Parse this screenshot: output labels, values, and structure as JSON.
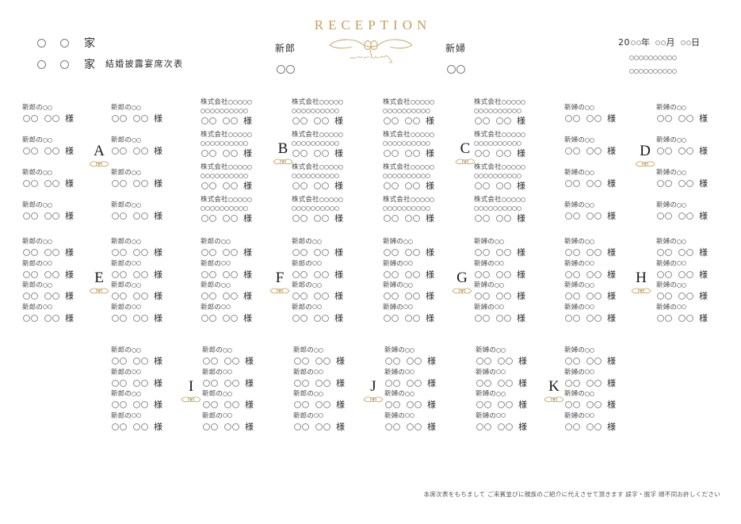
{
  "header": {
    "family_rows": [
      "家",
      "家"
    ],
    "subtitle": "結婚披露宴席次表",
    "reception_title": "RECEPTION",
    "ornament_script": "classic wedding",
    "groom_label": "新郎",
    "bride_label": "新婦",
    "date": {
      "year_prefix": "20",
      "year_suffix": "年",
      "month_suffix": "月",
      "day_suffix": "日"
    }
  },
  "labels": {
    "groom_relation": "新郎の",
    "bride_relation": "新婦の",
    "company": "株式会社",
    "honorific": "様"
  },
  "colors": {
    "gold": "#c2a05c",
    "ink": "#2e2e2e",
    "circle": "#8c8c8c"
  },
  "tables": [
    {
      "letter": "A",
      "type": "relative",
      "side": "groom"
    },
    {
      "letter": "B",
      "type": "company",
      "side": "company"
    },
    {
      "letter": "C",
      "type": "company",
      "side": "company"
    },
    {
      "letter": "D",
      "type": "relative",
      "side": "bride"
    },
    {
      "letter": "E",
      "type": "relative",
      "side": "groom"
    },
    {
      "letter": "F",
      "type": "relative",
      "side": "groom"
    },
    {
      "letter": "G",
      "type": "relative",
      "side": "bride"
    },
    {
      "letter": "H",
      "type": "relative",
      "side": "bride"
    },
    {
      "letter": "I",
      "type": "relative",
      "side": "groom"
    },
    {
      "letter": "J",
      "type": "relative",
      "side": "mixed"
    },
    {
      "letter": "K",
      "type": "relative",
      "side": "bride"
    }
  ],
  "footer": {
    "note": "本席次表をもちまして  ご来賓並びに親族のご紹介に代えさせて頂きます  誤字・脱字 順不同お許しください"
  }
}
